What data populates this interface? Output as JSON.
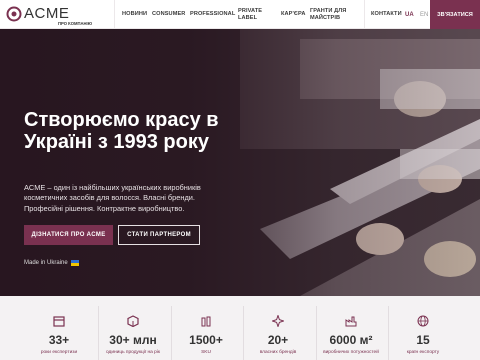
{
  "header": {
    "logo_text": "ACME",
    "logo_sub": "ПРО КОМПАНІЮ",
    "nav": [
      {
        "label": "НОВИНИ"
      },
      {
        "label": "CONSUMER"
      },
      {
        "label": "PROFESSIONAL"
      },
      {
        "label": "PRIVATE LABEL"
      },
      {
        "label": "КАР'ЄРА"
      },
      {
        "label": "ГРАНТИ ДЛЯ МАЙСТРІВ"
      },
      {
        "label": "КОНТАКТИ"
      }
    ],
    "lang_ua": "UA",
    "lang_en": "EN",
    "contact_button": "ЗВ'ЯЗАТИСЯ",
    "accent": "#7a3150"
  },
  "hero": {
    "title": "Створюємо красу в Україні з 1993 року",
    "description": "ACME – один із найбільших українських виробників косметичних засобів для волосся. Власні бренди. Професійні рішення. Контрактне виробництво.",
    "primary_button": "ДІЗНАТИСЯ ПРО ACME",
    "secondary_button": "СТАТИ ПАРТНЕРОМ",
    "made_in": "Made in Ukraine"
  },
  "stats": [
    {
      "value": "33+",
      "label": "роки експертизи",
      "icon": "calendar-icon"
    },
    {
      "value": "30+ млн",
      "label": "одиниць продукції на рік",
      "icon": "box-icon"
    },
    {
      "value": "1500+",
      "label": "SKU",
      "icon": "bottles-icon"
    },
    {
      "value": "20+",
      "label": "власних брендів",
      "icon": "sparkle-icon"
    },
    {
      "value": "6000 м²",
      "label": "виробничих потужностей",
      "icon": "factory-icon"
    },
    {
      "value": "15",
      "label": "країн експорту",
      "icon": "globe-icon"
    }
  ]
}
